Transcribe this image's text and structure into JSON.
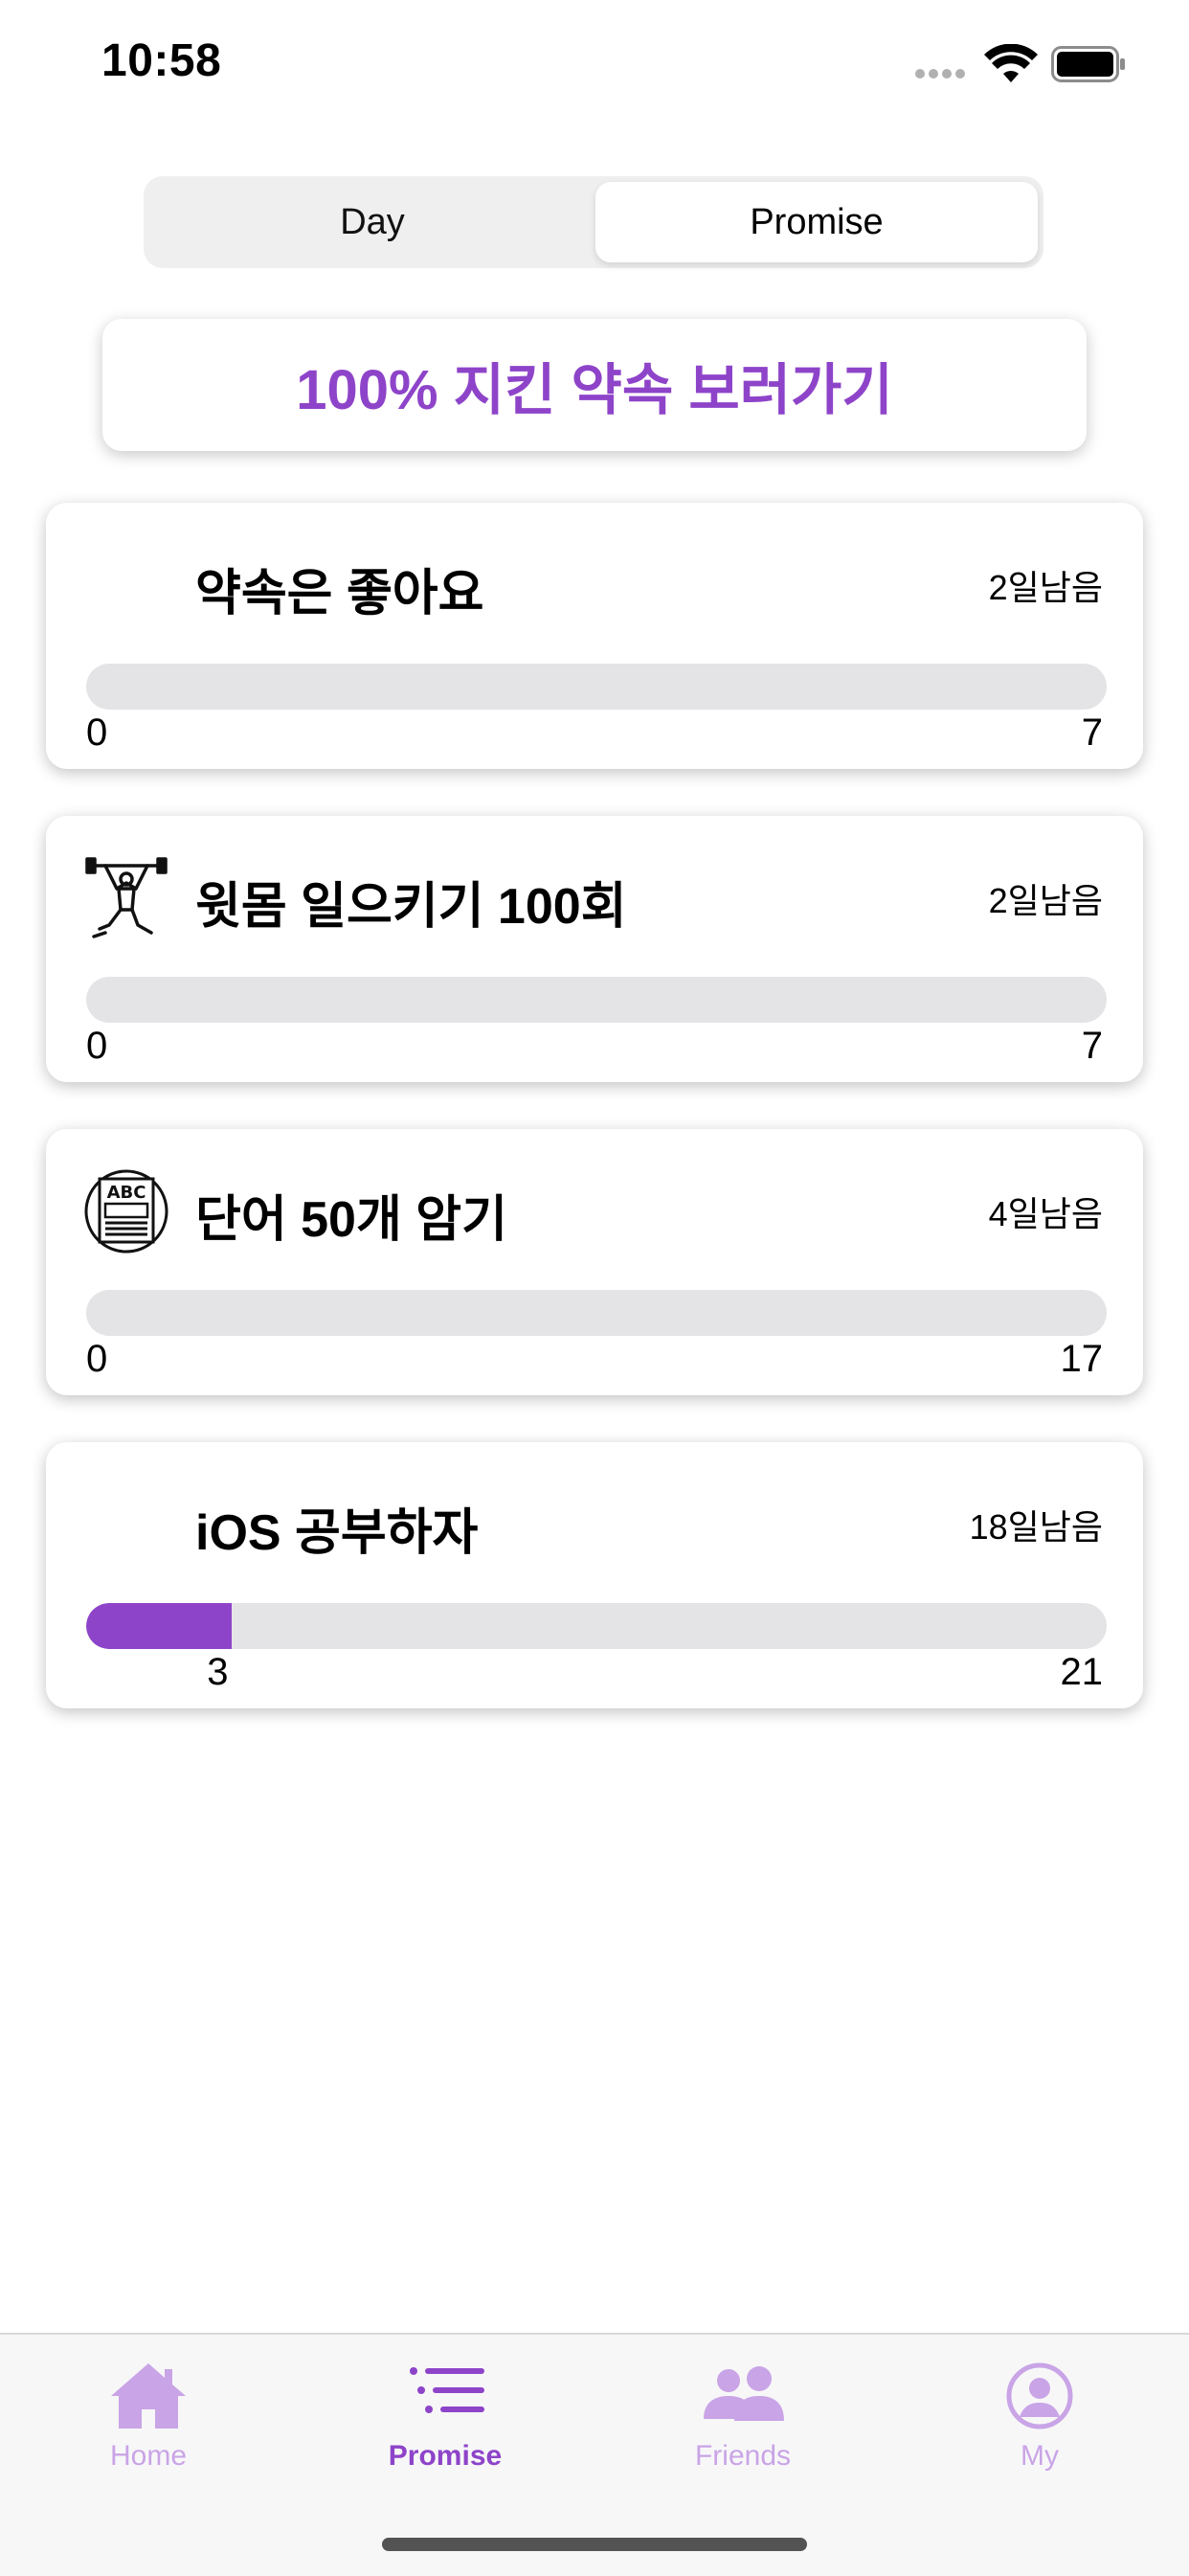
{
  "status_bar": {
    "time": "10:58"
  },
  "segmented": {
    "day_label": "Day",
    "promise_label": "Promise",
    "selected": "Promise"
  },
  "hundred_button": {
    "label": "100% 지킨 약속 보러가기"
  },
  "colors": {
    "accent": "#8e44c9",
    "accent_light": "#c9a4e6",
    "track": "#e4e4e6"
  },
  "promises": [
    {
      "icon": "none",
      "title": "약속은 좋아요",
      "remaining": "2일남음",
      "min": "0",
      "current": "",
      "current_value": 0,
      "max": "7",
      "max_value": 7
    },
    {
      "icon": "weightlifter-icon",
      "title": "윗몸 일으키기 100회",
      "remaining": "2일남음",
      "min": "0",
      "current": "",
      "current_value": 0,
      "max": "7",
      "max_value": 7
    },
    {
      "icon": "abc-book-icon",
      "title": "단어 50개 암기",
      "remaining": "4일남음",
      "min": "0",
      "current": "",
      "current_value": 0,
      "max": "17",
      "max_value": 17
    },
    {
      "icon": "none",
      "title": "iOS 공부하자",
      "remaining": "18일남음",
      "min": "",
      "current": "3",
      "current_value": 3,
      "max": "21",
      "max_value": 21
    }
  ],
  "tabs": [
    {
      "label": "Home",
      "icon": "home-icon",
      "active": false
    },
    {
      "label": "Promise",
      "icon": "list-icon",
      "active": true
    },
    {
      "label": "Friends",
      "icon": "friends-icon",
      "active": false
    },
    {
      "label": "My",
      "icon": "profile-icon",
      "active": false
    }
  ]
}
